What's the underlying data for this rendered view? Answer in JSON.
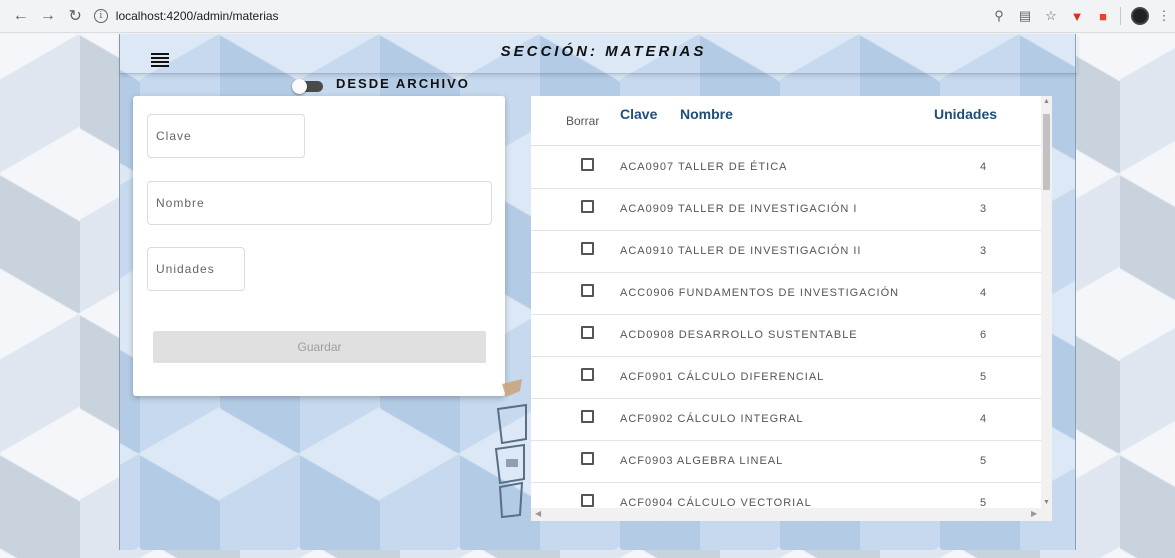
{
  "browser": {
    "url": "localhost:4200/admin/materias"
  },
  "header": {
    "section_title": "SECCIÓN: MATERIAS"
  },
  "toggle": {
    "label": "DESDE ARCHIVO",
    "on": false
  },
  "form": {
    "clave_placeholder": "Clave",
    "nombre_placeholder": "Nombre",
    "unidades_placeholder": "Unidades",
    "save_label": "Guardar"
  },
  "table": {
    "headers": {
      "borrar": "Borrar",
      "clave": "Clave",
      "nombre": "Nombre",
      "unidades": "Unidades"
    },
    "rows": [
      {
        "text": "ACA0907 TALLER DE ÉTICA",
        "unidades": "4"
      },
      {
        "text": "ACA0909 TALLER DE INVESTIGACIÓN I",
        "unidades": "3"
      },
      {
        "text": "ACA0910 TALLER DE INVESTIGACIÓN II",
        "unidades": "3"
      },
      {
        "text": "ACC0906 FUNDAMENTOS DE INVESTIGACIÓN",
        "unidades": "4"
      },
      {
        "text": "ACD0908 DESARROLLO SUSTENTABLE",
        "unidades": "6"
      },
      {
        "text": "ACF0901 CÁLCULO DIFERENCIAL",
        "unidades": "5"
      },
      {
        "text": "ACF0902 CÁLCULO INTEGRAL",
        "unidades": "4"
      },
      {
        "text": "ACF0903 ALGEBRA LINEAL",
        "unidades": "5"
      },
      {
        "text": "ACF0904 CÁLCULO VECTORIAL",
        "unidades": "5"
      }
    ]
  },
  "colors": {
    "header_accent": "#1f4e79"
  }
}
